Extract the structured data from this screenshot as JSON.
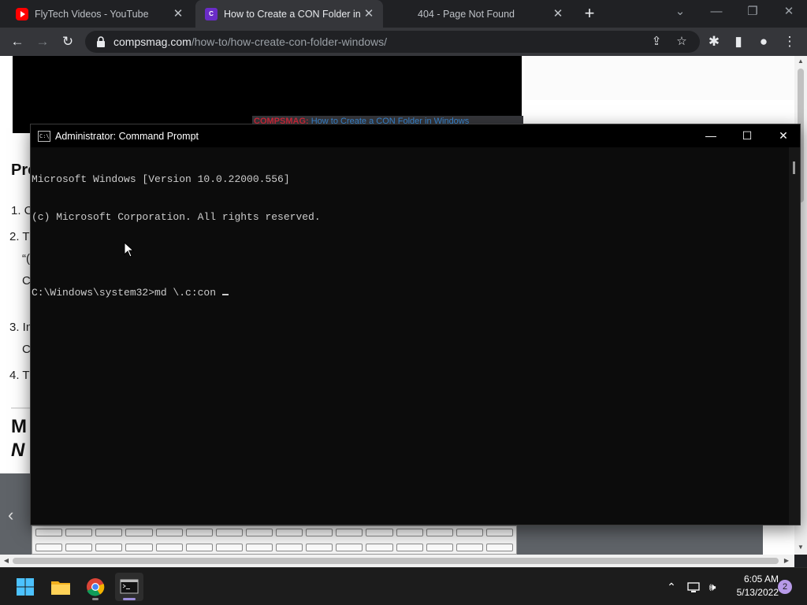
{
  "browser": {
    "tabs": [
      {
        "title": "FlyTech Videos - YouTube",
        "favicon": "youtube-icon",
        "active": false
      },
      {
        "title": "How to Create a CON Folder in W",
        "favicon": "compsmag-icon",
        "active": true
      },
      {
        "title": "404 - Page Not Found",
        "favicon": "",
        "active": false
      }
    ],
    "url_domain": "compsmag.com",
    "url_path": "/how-to/how-create-con-folder-windows/"
  },
  "webpage": {
    "video_caption_brand": "COMPSMAG:",
    "video_caption_rest": " How to Create a CON Folder in Windows",
    "heading_partial": "Pro",
    "list_fragments": [
      "1. C",
      "2. T",
      "“(",
      "C",
      "3. In",
      "C",
      "4. T"
    ],
    "section_heading_line1": "M",
    "section_heading_line2": "N"
  },
  "cmd": {
    "title": "Administrator: Command Prompt",
    "lines": [
      "Microsoft Windows [Version 10.0.22000.556]",
      "(c) Microsoft Corporation. All rights reserved.",
      "",
      "C:\\Windows\\system32>md \\.c:con "
    ]
  },
  "taskbar": {
    "apps": [
      "windows-start-icon",
      "file-explorer-icon",
      "chrome-icon",
      "terminal-icon"
    ],
    "time": "6:05 AM",
    "date": "5/13/2022",
    "notification_count": "2"
  },
  "colors": {
    "chrome_dark": "#202124",
    "chrome_toolbar": "#35363a",
    "cmd_bg": "#0c0c0c",
    "cmd_text": "#cccccc",
    "taskbar": "#1c1c1c"
  }
}
